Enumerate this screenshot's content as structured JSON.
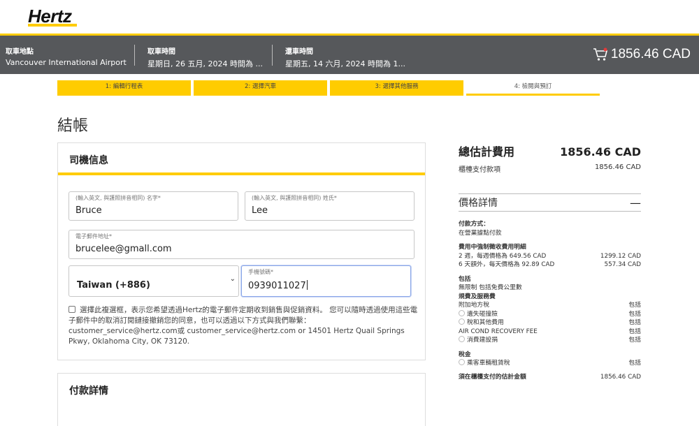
{
  "brand": {
    "logo_text": "Hertz",
    "accent": "#ffcc00",
    "header_bg": "#56585b"
  },
  "summary": {
    "pickup_location_label": "取車地點",
    "pickup_location_value": "Vancouver International Airport",
    "pickup_time_label": "取車時間",
    "pickup_time_value": "星期日, 26 五月, 2024 時間為 ...",
    "return_time_label": "還車時間",
    "return_time_value": "星期五, 14 六月, 2024 時間為 1...",
    "cart_icon": "shopping-cart-icon",
    "cart_total": "1856.46 CAD"
  },
  "steps": [
    {
      "label": "1:   編輯行程表"
    },
    {
      "label": "2:   選擇汽車"
    },
    {
      "label": "3:   選擇其他服務"
    },
    {
      "label": "4:   檢閱與預訂"
    }
  ],
  "page_title": "結帳",
  "driver": {
    "heading": "司機信息",
    "first_name_label": "(輸入英文, 與護照拼音相同) 名字*",
    "first_name_value": "Bruce",
    "last_name_label": "(輸入英文, 與護照拼音相同) 姓氏*",
    "last_name_value": "Lee",
    "email_label": "電子郵件地址*",
    "email_value": "brucelee@gmall.com",
    "country_code_value": "Taiwan (+886)",
    "phone_label": "手機號碼*",
    "phone_value": "0939011027",
    "consent_text": "選擇此複選框，表示您希望透過Hertz的電子郵件定期收到銷售與促銷資料。 您可以隨時透過使用這些電子郵件中的取消訂閱鏈接撤銷您的同意，也可以透過以下方式與我們聯繫：customer_service@hertz.com或 customer_service@hertz.com or 14501 Hertz Quail Springs Pkwy, Oklahoma City, OK 73120."
  },
  "payment": {
    "heading": "付款詳情"
  },
  "pricing": {
    "total_label": "總估計費用",
    "total_value": "1856.46 CAD",
    "counter_label": "櫃檯支付款項",
    "counter_value": "1856.46 CAD",
    "details_label": "價格詳情",
    "collapse_symbol": "—",
    "payment_method_label": "付款方式：",
    "payment_method_value": "在營業據點付款",
    "mandatory_label": "費用中強制徵收費用明細",
    "line1_label": "2 週，每週價格為 649.56 CAD",
    "line1_value": "1299.12 CAD",
    "line2_label": "6 天額外，每天價格為 92.89 CAD",
    "line2_value": "557.34 CAD",
    "included_label": "包括",
    "unlimited_label": "無限制 包括免費公里數",
    "fees_label": "規費及服務費",
    "fee1_label": "附加地方稅",
    "fee1_value": "包括",
    "fee2_label": "遺失碰撞險",
    "fee2_value": "包括",
    "fee3_label": "稅和其他費用",
    "fee3_value": "包括",
    "fee4_label": "AIR COND RECOVERY FEE",
    "fee4_value": "包括",
    "fee5_label": "消費建設捐",
    "fee5_value": "包括",
    "tax_label": "稅金",
    "tax1_label": "乘客車輛租賃稅",
    "tax1_value": "包括",
    "due_label": "須在櫃檯支付的估計金額",
    "due_value": "1856.46 CAD"
  }
}
